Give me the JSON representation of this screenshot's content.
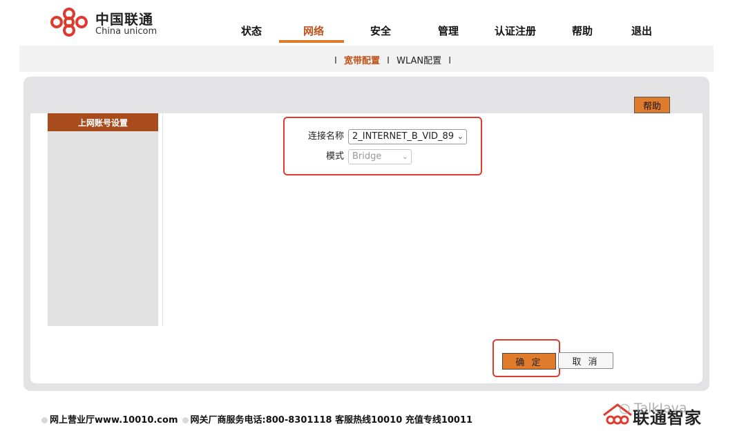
{
  "brand": {
    "name_cn": "中国联通",
    "name_en": "China unicom",
    "accent": "#e07b2c",
    "dark_accent": "#a94c1d",
    "logo_color": "#e03a2e"
  },
  "nav": {
    "items": [
      {
        "label": "状态"
      },
      {
        "label": "网络",
        "active": true
      },
      {
        "label": "安全"
      },
      {
        "label": "管理"
      },
      {
        "label": "认证注册"
      },
      {
        "label": "帮助"
      },
      {
        "label": "退出"
      }
    ]
  },
  "subnav": {
    "items": [
      {
        "label": "宽带配置",
        "active": true
      },
      {
        "label": "WLAN配置"
      }
    ],
    "separator": "I"
  },
  "panel": {
    "help_label": "帮助"
  },
  "sidebar": {
    "title": "上网账号设置"
  },
  "form": {
    "connection_label": "连接名称",
    "connection_value": "2_INTERNET_B_VID_89",
    "mode_label": "模式",
    "mode_value": "Bridge"
  },
  "buttons": {
    "ok_label": "确 定",
    "cancel_label": "取 消"
  },
  "footer": {
    "text1": "网上营业厅www.10010.com",
    "text2": "网关厂商服务电话:800-8301118 客服热线10010 充值专线10011",
    "logo_text": "联通智家",
    "watermark": "TalkJava"
  }
}
